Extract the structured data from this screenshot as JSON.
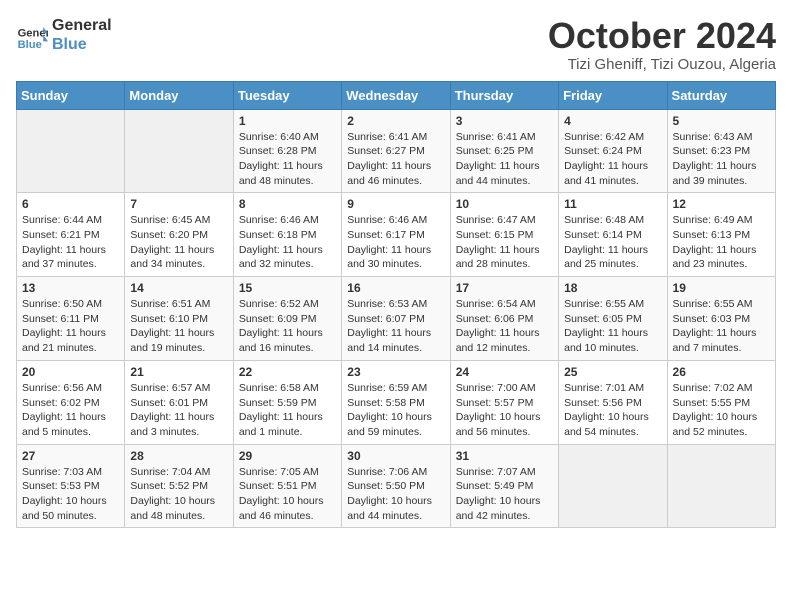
{
  "header": {
    "logo_general": "General",
    "logo_blue": "Blue",
    "month": "October 2024",
    "location": "Tizi Gheniff, Tizi Ouzou, Algeria"
  },
  "days_of_week": [
    "Sunday",
    "Monday",
    "Tuesday",
    "Wednesday",
    "Thursday",
    "Friday",
    "Saturday"
  ],
  "weeks": [
    [
      {
        "day": "",
        "detail": ""
      },
      {
        "day": "",
        "detail": ""
      },
      {
        "day": "1",
        "detail": "Sunrise: 6:40 AM\nSunset: 6:28 PM\nDaylight: 11 hours and 48 minutes."
      },
      {
        "day": "2",
        "detail": "Sunrise: 6:41 AM\nSunset: 6:27 PM\nDaylight: 11 hours and 46 minutes."
      },
      {
        "day": "3",
        "detail": "Sunrise: 6:41 AM\nSunset: 6:25 PM\nDaylight: 11 hours and 44 minutes."
      },
      {
        "day": "4",
        "detail": "Sunrise: 6:42 AM\nSunset: 6:24 PM\nDaylight: 11 hours and 41 minutes."
      },
      {
        "day": "5",
        "detail": "Sunrise: 6:43 AM\nSunset: 6:23 PM\nDaylight: 11 hours and 39 minutes."
      }
    ],
    [
      {
        "day": "6",
        "detail": "Sunrise: 6:44 AM\nSunset: 6:21 PM\nDaylight: 11 hours and 37 minutes."
      },
      {
        "day": "7",
        "detail": "Sunrise: 6:45 AM\nSunset: 6:20 PM\nDaylight: 11 hours and 34 minutes."
      },
      {
        "day": "8",
        "detail": "Sunrise: 6:46 AM\nSunset: 6:18 PM\nDaylight: 11 hours and 32 minutes."
      },
      {
        "day": "9",
        "detail": "Sunrise: 6:46 AM\nSunset: 6:17 PM\nDaylight: 11 hours and 30 minutes."
      },
      {
        "day": "10",
        "detail": "Sunrise: 6:47 AM\nSunset: 6:15 PM\nDaylight: 11 hours and 28 minutes."
      },
      {
        "day": "11",
        "detail": "Sunrise: 6:48 AM\nSunset: 6:14 PM\nDaylight: 11 hours and 25 minutes."
      },
      {
        "day": "12",
        "detail": "Sunrise: 6:49 AM\nSunset: 6:13 PM\nDaylight: 11 hours and 23 minutes."
      }
    ],
    [
      {
        "day": "13",
        "detail": "Sunrise: 6:50 AM\nSunset: 6:11 PM\nDaylight: 11 hours and 21 minutes."
      },
      {
        "day": "14",
        "detail": "Sunrise: 6:51 AM\nSunset: 6:10 PM\nDaylight: 11 hours and 19 minutes."
      },
      {
        "day": "15",
        "detail": "Sunrise: 6:52 AM\nSunset: 6:09 PM\nDaylight: 11 hours and 16 minutes."
      },
      {
        "day": "16",
        "detail": "Sunrise: 6:53 AM\nSunset: 6:07 PM\nDaylight: 11 hours and 14 minutes."
      },
      {
        "day": "17",
        "detail": "Sunrise: 6:54 AM\nSunset: 6:06 PM\nDaylight: 11 hours and 12 minutes."
      },
      {
        "day": "18",
        "detail": "Sunrise: 6:55 AM\nSunset: 6:05 PM\nDaylight: 11 hours and 10 minutes."
      },
      {
        "day": "19",
        "detail": "Sunrise: 6:55 AM\nSunset: 6:03 PM\nDaylight: 11 hours and 7 minutes."
      }
    ],
    [
      {
        "day": "20",
        "detail": "Sunrise: 6:56 AM\nSunset: 6:02 PM\nDaylight: 11 hours and 5 minutes."
      },
      {
        "day": "21",
        "detail": "Sunrise: 6:57 AM\nSunset: 6:01 PM\nDaylight: 11 hours and 3 minutes."
      },
      {
        "day": "22",
        "detail": "Sunrise: 6:58 AM\nSunset: 5:59 PM\nDaylight: 11 hours and 1 minute."
      },
      {
        "day": "23",
        "detail": "Sunrise: 6:59 AM\nSunset: 5:58 PM\nDaylight: 10 hours and 59 minutes."
      },
      {
        "day": "24",
        "detail": "Sunrise: 7:00 AM\nSunset: 5:57 PM\nDaylight: 10 hours and 56 minutes."
      },
      {
        "day": "25",
        "detail": "Sunrise: 7:01 AM\nSunset: 5:56 PM\nDaylight: 10 hours and 54 minutes."
      },
      {
        "day": "26",
        "detail": "Sunrise: 7:02 AM\nSunset: 5:55 PM\nDaylight: 10 hours and 52 minutes."
      }
    ],
    [
      {
        "day": "27",
        "detail": "Sunrise: 7:03 AM\nSunset: 5:53 PM\nDaylight: 10 hours and 50 minutes."
      },
      {
        "day": "28",
        "detail": "Sunrise: 7:04 AM\nSunset: 5:52 PM\nDaylight: 10 hours and 48 minutes."
      },
      {
        "day": "29",
        "detail": "Sunrise: 7:05 AM\nSunset: 5:51 PM\nDaylight: 10 hours and 46 minutes."
      },
      {
        "day": "30",
        "detail": "Sunrise: 7:06 AM\nSunset: 5:50 PM\nDaylight: 10 hours and 44 minutes."
      },
      {
        "day": "31",
        "detail": "Sunrise: 7:07 AM\nSunset: 5:49 PM\nDaylight: 10 hours and 42 minutes."
      },
      {
        "day": "",
        "detail": ""
      },
      {
        "day": "",
        "detail": ""
      }
    ]
  ]
}
